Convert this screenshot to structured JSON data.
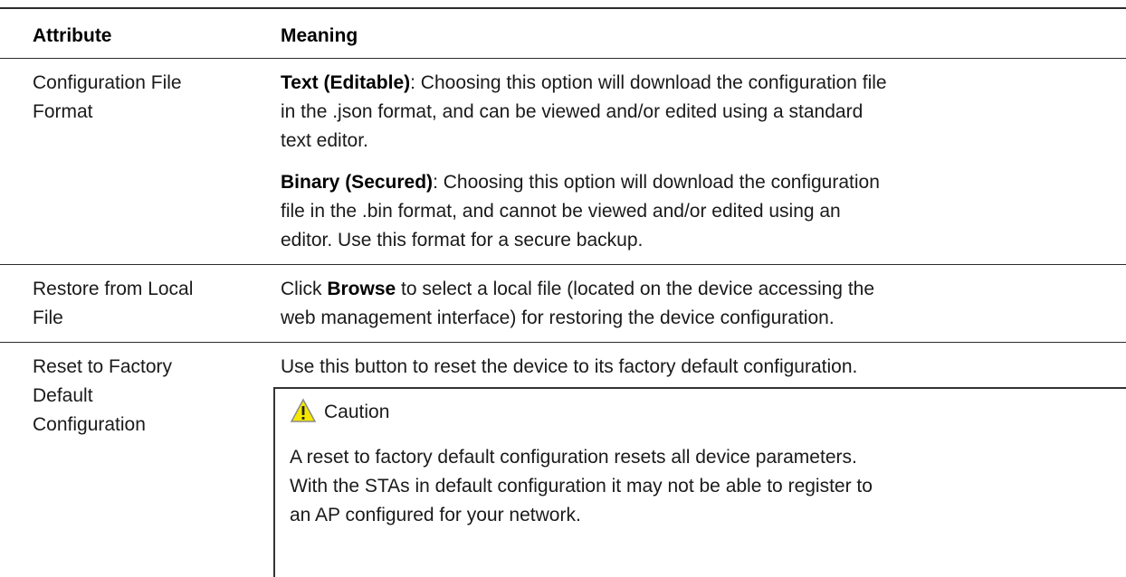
{
  "table": {
    "headers": {
      "attribute": "Attribute",
      "meaning": "Meaning"
    },
    "rows": [
      {
        "attribute_lines": [
          "Configuration File",
          "Format"
        ],
        "paragraphs": [
          {
            "bold": "Text (Editable)",
            "lines": [
              ": Choosing this option will download the configuration file",
              "in the .json format, and can be viewed and/or edited using a standard",
              "text editor."
            ]
          },
          {
            "bold": "Binary (Secured)",
            "lines": [
              ": Choosing this option will download the configuration",
              "file in the .bin format, and cannot be viewed and/or edited using an",
              "editor. Use this format for a secure backup."
            ]
          }
        ]
      },
      {
        "attribute_lines": [
          "Restore from Local",
          "File"
        ],
        "line1_pre": "Click ",
        "line1_bold": "Browse",
        "line1_post": " to select a local file (located on the device accessing the",
        "line2": "web management interface) for restoring the device configuration."
      },
      {
        "attribute_lines": [
          "Reset to Factory",
          "Default",
          "Configuration"
        ],
        "line1": "Use this button to reset the device to its factory default configuration.",
        "caution": {
          "icon": "warning-triangle-icon",
          "title": "Caution",
          "lines": [
            "A reset to factory default configuration resets all device parameters.",
            "With the STAs in default configuration it may not be able to register to",
            "an AP configured for your network."
          ]
        }
      }
    ]
  }
}
